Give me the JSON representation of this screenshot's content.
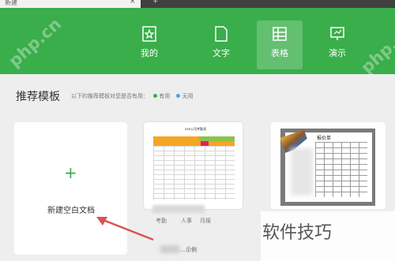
{
  "tab": {
    "label": "新建",
    "close": "×",
    "add": "+"
  },
  "ribbon": {
    "items": [
      {
        "label": "我的",
        "icon": "star-doc-icon"
      },
      {
        "label": "文字",
        "icon": "document-icon"
      },
      {
        "label": "表格",
        "icon": "table-icon",
        "active": true
      },
      {
        "label": "演示",
        "icon": "presentation-icon"
      },
      {
        "label": ""
      }
    ]
  },
  "watermark_top": "php.cn",
  "templates": {
    "heading": "推荐模板",
    "hint": "以下的推荐模板对您是否有用：",
    "useful": "有用",
    "useless": "无用"
  },
  "new_blank": {
    "plus": "+",
    "label": "新建空白文档"
  },
  "template1": {
    "title": "xxx公司考勤表",
    "tags": [
      "考勤",
      "人事",
      "月报"
    ]
  },
  "template2": {
    "title": "报价单"
  },
  "file_name": "…示例",
  "watermark_bottom": "软件技巧",
  "colors": {
    "brand_green": "#39ae4a",
    "background": "#eeeeee"
  }
}
